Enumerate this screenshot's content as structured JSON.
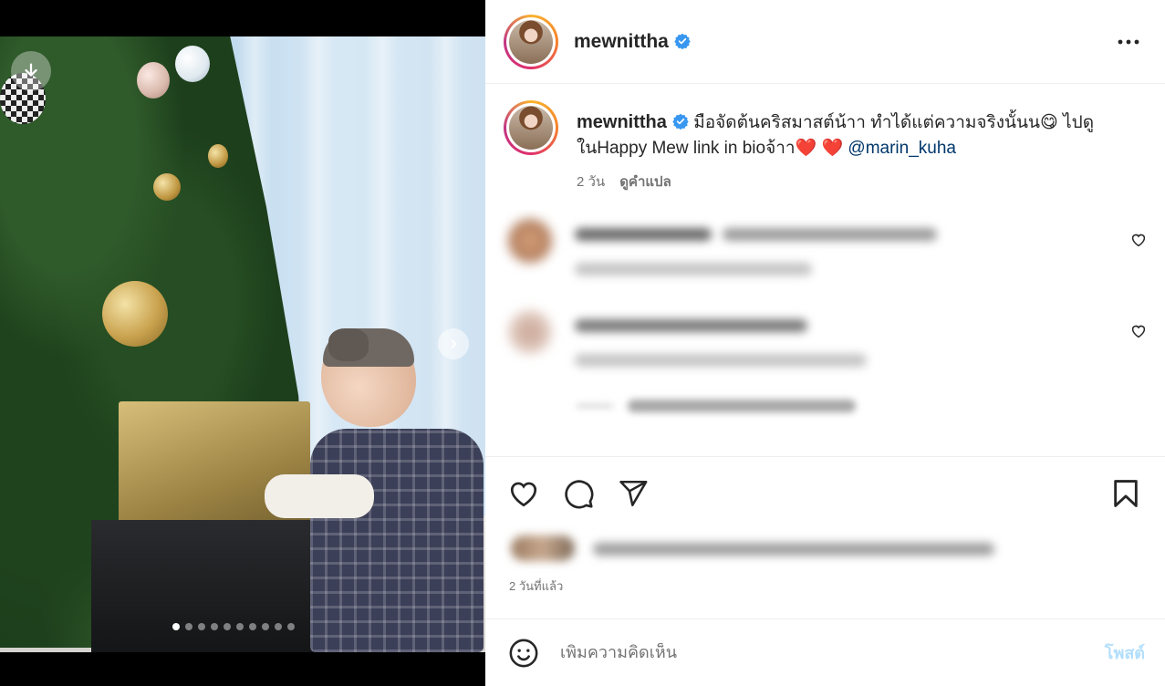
{
  "post": {
    "username": "mewnittha",
    "caption_text": "มือจัดต้นคริสมาสต์น้าา ทำได้แต่ความจริงนั้นน😋 ไปดูในHappy Mew link in bioจ้าา",
    "caption_hearts": "❤️ ❤️",
    "mention": "@marin_kuha",
    "caption_age": "2 วัน",
    "translate_label": "ดูคำแปล",
    "timestamp": "2 วันที่แล้ว"
  },
  "media": {
    "slide_count": 10,
    "active_slide": 1
  },
  "comment_box": {
    "placeholder": "เพิ่มความคิดเห็น",
    "post_label": "โพสต์"
  },
  "icons": {
    "verified": "verified-badge-icon",
    "more": "more-options-icon",
    "like": "heart-icon",
    "comment": "comment-icon",
    "share": "share-icon",
    "save": "bookmark-icon",
    "emoji": "emoji-icon",
    "next": "chevron-right-icon",
    "download": "download-icon"
  },
  "colors": {
    "verified_blue": "#3897f0",
    "mention": "#00376b",
    "post_button_disabled": "#b2dffc"
  }
}
